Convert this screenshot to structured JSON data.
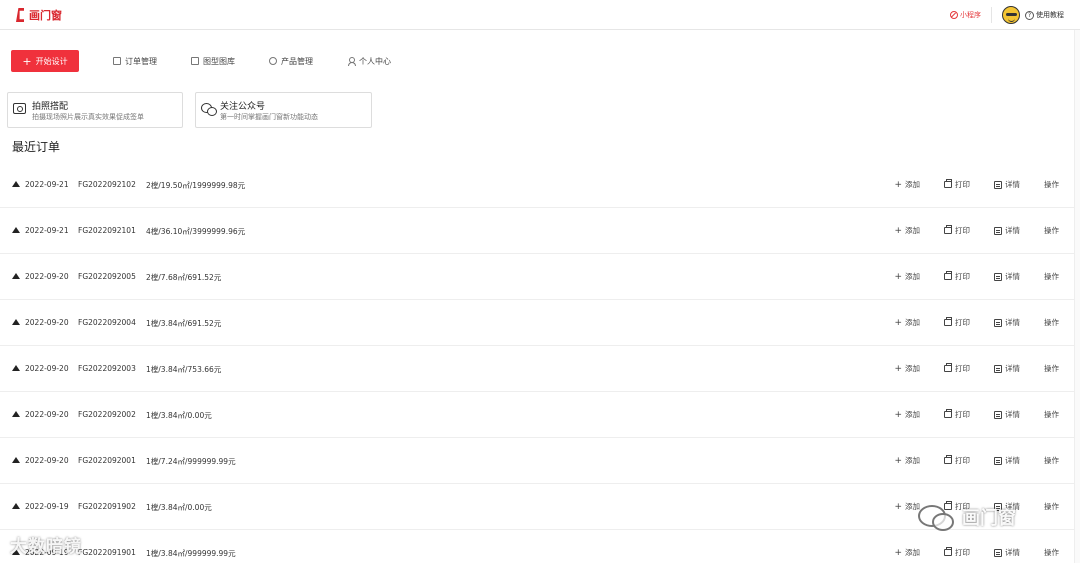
{
  "header": {
    "logo_text": "画门窗",
    "mini_program": "小程序",
    "help": "使用教程"
  },
  "nav": {
    "start_design": "开始设计",
    "items": [
      {
        "label": "订单管理",
        "icon": "order-icon"
      },
      {
        "label": "图型图库",
        "icon": "gallery-icon"
      },
      {
        "label": "产品管理",
        "icon": "product-icon"
      },
      {
        "label": "个人中心",
        "icon": "person-icon"
      }
    ]
  },
  "cards": [
    {
      "title": "拍照搭配",
      "subtitle": "拍摄现场照片展示真实效果促成签单",
      "icon": "camera-icon"
    },
    {
      "title": "关注公众号",
      "subtitle": "第一时间掌握画门窗新功能动态",
      "icon": "wechat-icon"
    }
  ],
  "section_title": "最近订单",
  "actions": {
    "add": "添加",
    "print": "打印",
    "detail": "详情",
    "operate": "操作"
  },
  "orders": [
    {
      "date": "2022-09-21",
      "number": "FG2022092102",
      "summary": "2樘/19.50㎡/1999999.98元"
    },
    {
      "date": "2022-09-21",
      "number": "FG2022092101",
      "summary": "4樘/36.10㎡/3999999.96元"
    },
    {
      "date": "2022-09-20",
      "number": "FG2022092005",
      "summary": "2樘/7.68㎡/691.52元"
    },
    {
      "date": "2022-09-20",
      "number": "FG2022092004",
      "summary": "1樘/3.84㎡/691.52元"
    },
    {
      "date": "2022-09-20",
      "number": "FG2022092003",
      "summary": "1樘/3.84㎡/753.66元"
    },
    {
      "date": "2022-09-20",
      "number": "FG2022092002",
      "summary": "1樘/3.84㎡/0.00元"
    },
    {
      "date": "2022-09-20",
      "number": "FG2022092001",
      "summary": "1樘/7.24㎡/999999.99元"
    },
    {
      "date": "2022-09-19",
      "number": "FG2022091902",
      "summary": "1樘/3.84㎡/0.00元"
    },
    {
      "date": "2022-09-19",
      "number": "FG2022091901",
      "summary": "1樘/3.84㎡/999999.99元"
    }
  ],
  "watermarks": {
    "left": "大数暗镜",
    "right": "画门窗"
  },
  "colors": {
    "accent": "#f0313c",
    "logo": "#d9272e"
  }
}
